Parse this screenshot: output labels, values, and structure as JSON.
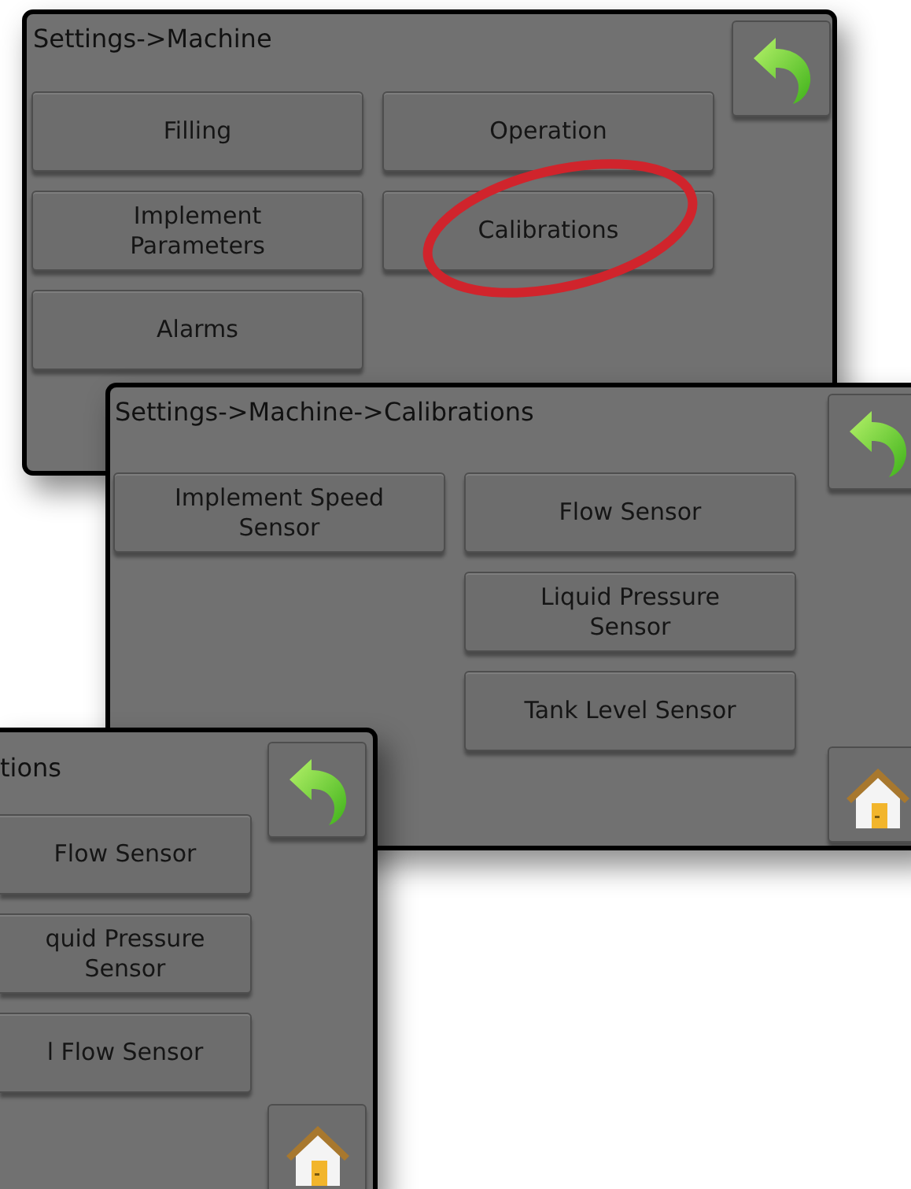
{
  "screens": [
    {
      "title": "Settings->Machine",
      "nav": [
        {
          "kind": "back"
        }
      ],
      "columns": [
        [
          {
            "label": "Filling",
            "circled": false
          },
          {
            "label": "Implement Parameters",
            "circled": false
          },
          {
            "label": "Alarms",
            "circled": false
          }
        ],
        [
          {
            "label": "Operation",
            "circled": false
          },
          {
            "label": "Calibrations",
            "circled": true
          }
        ]
      ]
    },
    {
      "title": "Settings->Machine->Calibrations",
      "nav": [
        {
          "kind": "back"
        },
        {
          "kind": "home"
        }
      ],
      "columns": [
        [
          {
            "label": "Implement Speed Sensor",
            "circled": false
          }
        ],
        [
          {
            "label": "Flow Sensor",
            "circled": false
          },
          {
            "label": "Liquid Pressure Sensor",
            "circled": false
          },
          {
            "label": "Tank Level Sensor",
            "circled": false
          }
        ]
      ]
    },
    {
      "title": "tions",
      "nav": [
        {
          "kind": "back"
        },
        {
          "kind": "home"
        }
      ],
      "columns": [
        [
          {
            "label": "Flow Sensor",
            "circled": false
          },
          {
            "label": "quid Pressure Sensor",
            "circled": false
          },
          {
            "label": "l Flow Sensor",
            "circled": false
          }
        ]
      ]
    }
  ]
}
